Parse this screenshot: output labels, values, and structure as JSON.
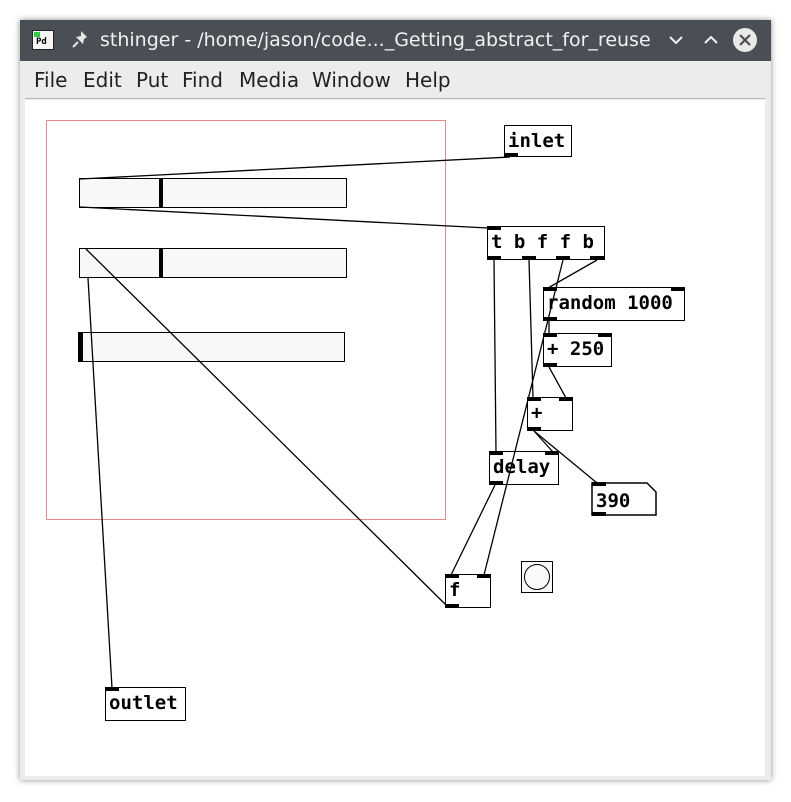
{
  "window": {
    "title": "sthinger - /home/jason/code..._Getting_abstract_for_reuse",
    "app_icon_text": "Pd"
  },
  "menu": {
    "items": [
      "File",
      "Edit",
      "Put",
      "Find",
      "Media",
      "Window",
      "Help"
    ]
  },
  "patch": {
    "objects": {
      "inlet": "inlet",
      "trigger": "t b f f b",
      "random": "random 1000",
      "plus250": "+ 250",
      "plus": "+",
      "delay": "delay",
      "float": "f",
      "outlet": "outlet"
    },
    "number_box_value": "390",
    "sliders": [
      {
        "name": "slider-1",
        "value_fraction": 0.3
      },
      {
        "name": "slider-2",
        "value_fraction": 0.3
      },
      {
        "name": "slider-3",
        "value_fraction": 0.0
      }
    ]
  },
  "colors": {
    "titlebar": "#4a4f55",
    "gop_frame": "#e5888e",
    "menubar": "#ececec"
  }
}
